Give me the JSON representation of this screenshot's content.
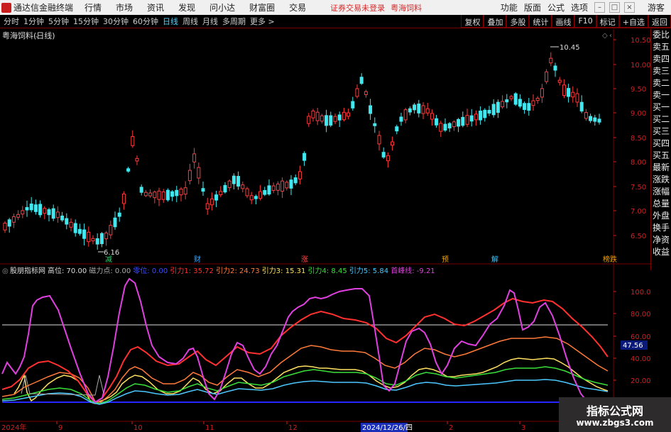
{
  "menubar": {
    "app_name": "通达信金融终端",
    "menus": [
      "行情",
      "市场",
      "资讯",
      "发现",
      "问小达",
      "财富圈",
      "交易"
    ],
    "status1": "证券交易未登录",
    "status2": "粤海饲料",
    "right": [
      "功能",
      "版面",
      "公式",
      "选项"
    ],
    "guest": "游客"
  },
  "periodbar": {
    "periods": [
      "分时",
      "1分钟",
      "5分钟",
      "15分钟",
      "30分钟",
      "60分钟",
      "日线",
      "周线",
      "月线",
      "多周期",
      "更多 >"
    ],
    "active": "日线",
    "tools": [
      "复权",
      "叠加",
      "多股",
      "统计",
      "画线",
      "F10",
      "标记",
      "+自选",
      "返回"
    ]
  },
  "sidepanel": [
    "委比",
    "卖五",
    "卖四",
    "卖三",
    "卖二",
    "卖一",
    "买一",
    "买二",
    "买三",
    "买四",
    "买五",
    "最新",
    "涨跌",
    "涨幅",
    "总量",
    "外盘",
    "换手",
    "净资",
    "收益"
  ],
  "main_chart": {
    "title": "粤海饲料(日线)",
    "high_label": "10.45",
    "low_label": "6.16",
    "markers": [
      "减",
      "财",
      "涨",
      "预",
      "解",
      "榜跌"
    ],
    "marker_colors": [
      "#1fd36b",
      "#39a7ff",
      "#ff4a4a",
      "#f0a000",
      "#39c5ff",
      "#f0a000"
    ],
    "price_ticks": [
      "10.50",
      "10.00",
      "9.50",
      "9.00",
      "8.50",
      "8.00",
      "7.50",
      "7.00",
      "6.50"
    ]
  },
  "indicator": {
    "name": "股朋指标网",
    "params": [
      {
        "label": "高位:",
        "value": "70.00",
        "color": "#dddddd"
      },
      {
        "label": "磁力点:",
        "value": "0.00",
        "color": "#aaaaaa"
      },
      {
        "label": "零位:",
        "value": "0.00",
        "color": "#3d4dff"
      },
      {
        "label": "引力1:",
        "value": "35.72",
        "color": "#ff3030"
      },
      {
        "label": "引力2:",
        "value": "24.73",
        "color": "#ff7a3a"
      },
      {
        "label": "引力3:",
        "value": "15.31",
        "color": "#ffe060"
      },
      {
        "label": "引力4:",
        "value": "8.45",
        "color": "#3ae03a"
      },
      {
        "label": "引力5:",
        "value": "5.84",
        "color": "#4cc8ff"
      },
      {
        "label": "首峰线:",
        "value": "-9.21",
        "color": "#e040e0"
      }
    ],
    "ticks": [
      "100.0",
      "80.00",
      "60.00",
      "40.00",
      "20.00"
    ],
    "current_value": "47.56"
  },
  "date_axis": {
    "labels": [
      "2024年",
      "9",
      "10",
      "11",
      "12",
      "2024/12/26/四",
      "2",
      "3"
    ],
    "cursor_index": 5
  },
  "watermark": {
    "line1": "指标公式网",
    "line2": "www.zbgs3.com"
  }
}
